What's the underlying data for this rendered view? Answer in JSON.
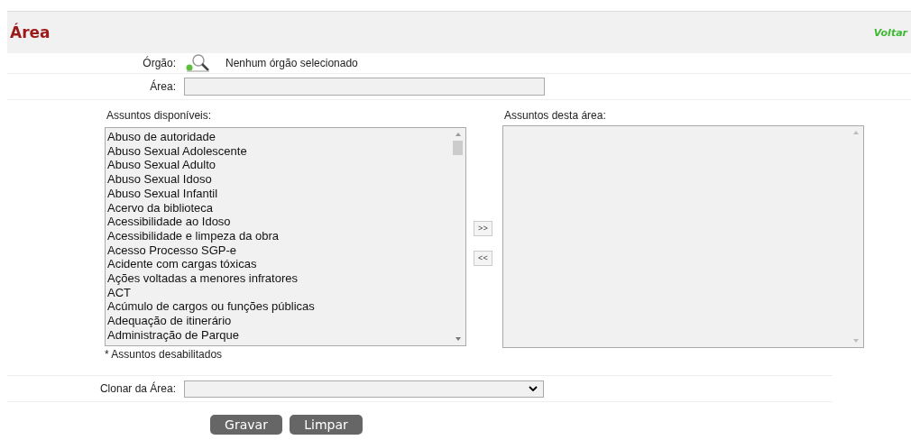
{
  "header": {
    "title": "Área",
    "back_link": "Voltar"
  },
  "orgao": {
    "label": "Órgão:",
    "value": "Nenhum órgão selecionado"
  },
  "area": {
    "label": "Área:"
  },
  "available": {
    "label": "Assuntos disponíveis:",
    "items": [
      "Abuso de autoridade",
      "Abuso Sexual Adolescente",
      "Abuso Sexual Adulto",
      "Abuso Sexual Idoso",
      "Abuso Sexual Infantil",
      "Acervo da biblioteca",
      "Acessibilidade ao Idoso",
      "Acessibilidade e limpeza da obra",
      "Acesso Processo SGP-e",
      "Acidente com cargas tóxicas",
      "Ações voltadas a menores infratores",
      "ACT",
      "Acúmulo de cargos ou funções públicas",
      "Adequação de itinerário",
      "Administração de Parque"
    ],
    "note": "* Assuntos desabilitados"
  },
  "move_buttons": [
    ">>",
    "<<"
  ],
  "assigned": {
    "label": "Assuntos desta área:"
  },
  "clone": {
    "label": "Clonar da Área:"
  },
  "buttons": [
    "Gravar",
    "Limpar"
  ]
}
